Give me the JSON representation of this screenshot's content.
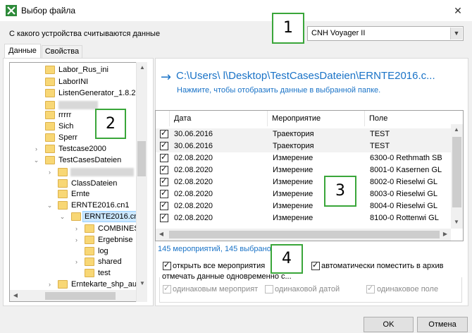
{
  "window": {
    "title": "Выбор файла",
    "close": "✕"
  },
  "device": {
    "label": "С какого устройства считываются данные",
    "selected": "CNH Voyager II"
  },
  "callouts": [
    "1",
    "2",
    "3",
    "4"
  ],
  "tabs": [
    {
      "label": "Данные"
    },
    {
      "label": "Свойства"
    }
  ],
  "tree": {
    "items": [
      {
        "label": "Labor_Rus_ini"
      },
      {
        "label": "LaborINI"
      },
      {
        "label": "ListenGenerator_1.8.2"
      },
      {
        "label": ""
      },
      {
        "label": "rrrrr"
      },
      {
        "label": "Sich"
      },
      {
        "label": "Sperr"
      },
      {
        "label": "Testcase2000"
      },
      {
        "label": "TestCasesDateien"
      },
      {
        "label": ""
      },
      {
        "label": "ClassDateien"
      },
      {
        "label": "Ernte"
      },
      {
        "label": "ERNTE2016.cn1"
      },
      {
        "label": "ERNTE2016.cn"
      },
      {
        "label": "COMBINES"
      },
      {
        "label": "Ergebnise"
      },
      {
        "label": "log"
      },
      {
        "label": "shared"
      },
      {
        "label": "test"
      },
      {
        "label": "Erntekarte_shp_au"
      }
    ]
  },
  "path": {
    "arrow": "→",
    "text": "C:\\Users\\          l\\Desktop\\TestCasesDateien\\ERNTE2016.c...",
    "hint": "Нажмите, чтобы отобразить данные в выбранной папке."
  },
  "grid": {
    "columns": [
      "Дата",
      "Мероприятие",
      "Поле"
    ],
    "rows": [
      {
        "date": "30.06.2016",
        "event": "Траектория",
        "field": "TEST"
      },
      {
        "date": "30.06.2016",
        "event": "Траектория",
        "field": "TEST"
      },
      {
        "date": "02.08.2020",
        "event": "Измерение",
        "field": "6300-0 Rethmath SB"
      },
      {
        "date": "02.08.2020",
        "event": "Измерение",
        "field": "8001-0 Kasernen GL"
      },
      {
        "date": "02.08.2020",
        "event": "Измерение",
        "field": "8002-0 Rieselwi GL"
      },
      {
        "date": "02.08.2020",
        "event": "Измерение",
        "field": "8003-0 Rieselwi GL"
      },
      {
        "date": "02.08.2020",
        "event": "Измерение",
        "field": "8004-0 Rieselwi GL"
      },
      {
        "date": "02.08.2020",
        "event": "Измерение",
        "field": "8100-0 Rottenwi GL"
      }
    ]
  },
  "count_text": "145 мероприятий, 145 выбрано",
  "options": {
    "open_all": "открыть все мероприятия",
    "auto_archive": "автоматически поместить в архив",
    "group_label": "отмечать данные одновременно с...",
    "same_event": "одинаковым мероприят",
    "same_date": "одинаковой датой",
    "same_field": "одинаковое поле"
  },
  "buttons": {
    "ok": "OK",
    "cancel": "Отмена"
  }
}
